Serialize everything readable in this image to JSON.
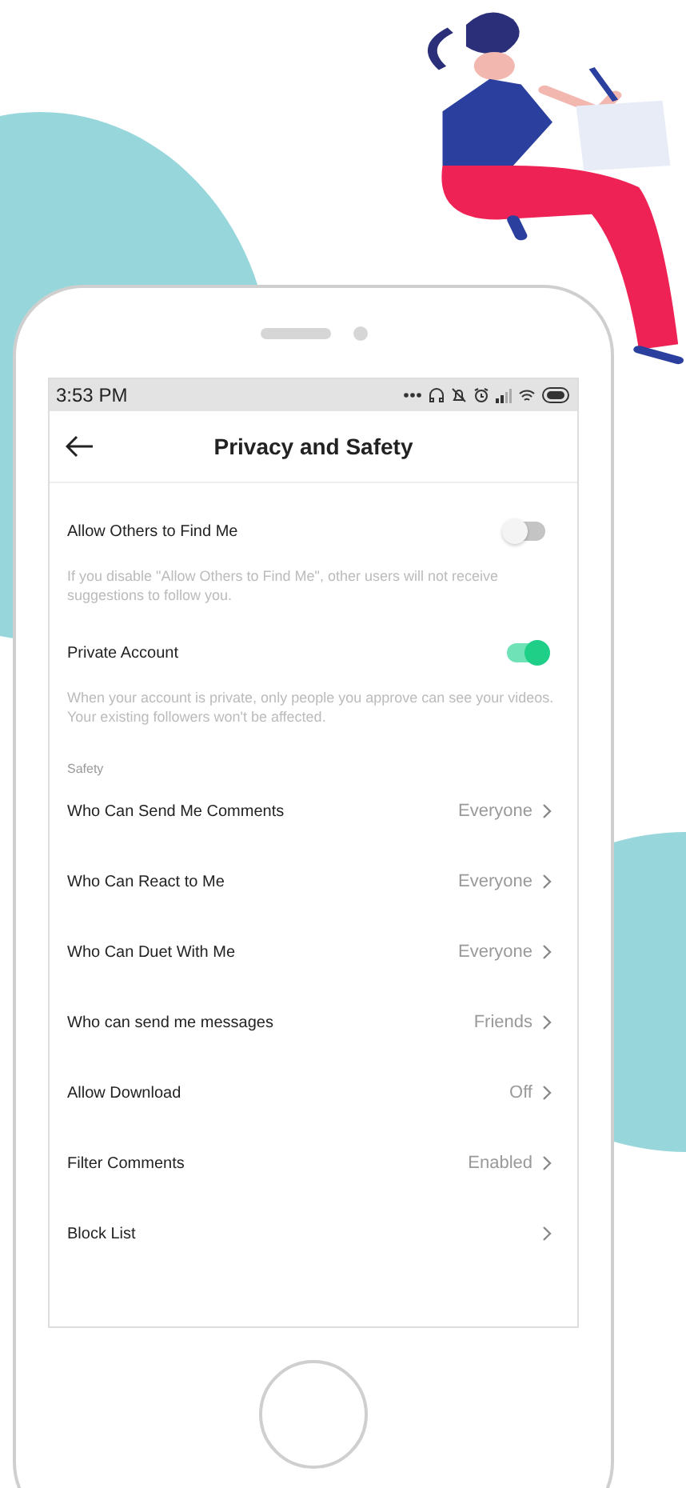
{
  "status_bar": {
    "time": "3:53 PM"
  },
  "header": {
    "title": "Privacy and Safety"
  },
  "toggles": [
    {
      "label": "Allow Others to Find Me",
      "on": false,
      "description": "If you disable \"Allow Others to Find Me\", other users will not receive suggestions to follow you."
    },
    {
      "label": "Private Account",
      "on": true,
      "description": "When your account is private, only people you approve can see your videos. Your existing followers won't be affected."
    }
  ],
  "section_label": "Safety",
  "rows": [
    {
      "label": "Who Can Send Me Comments",
      "value": "Everyone"
    },
    {
      "label": "Who Can React to Me",
      "value": "Everyone"
    },
    {
      "label": "Who Can Duet With Me",
      "value": "Everyone"
    },
    {
      "label": "Who can send me messages",
      "value": "Friends"
    },
    {
      "label": "Allow Download",
      "value": "Off"
    },
    {
      "label": "Filter Comments",
      "value": "Enabled"
    },
    {
      "label": "Block List"
    }
  ]
}
